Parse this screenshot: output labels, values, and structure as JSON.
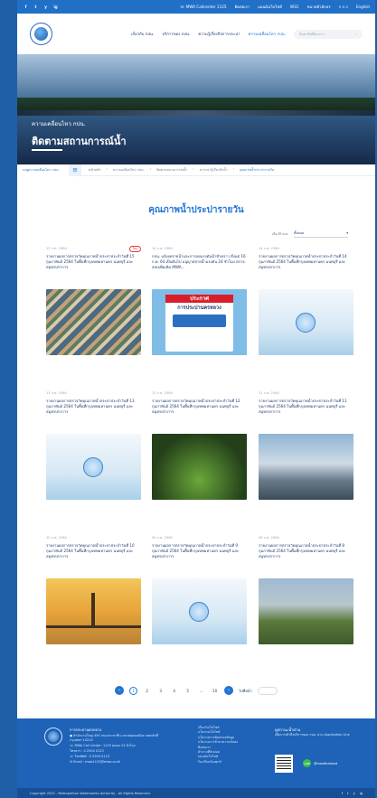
{
  "topbar": {
    "social": [
      "f",
      "t",
      "y",
      "ig"
    ],
    "callcenter": "MWA Callcenter 1125",
    "links": [
      "ติดต่อเรา",
      "แผนผังเว็บไซต์",
      "W3C",
      "ขนาดตัวอักษร",
      "ก ก ก",
      "English"
    ]
  },
  "header": {
    "nav": [
      "เกี่ยวกับ กปน.",
      "บริการของ กปน.",
      "ความรู้เรื่องกิจการประปา",
      "ความเคลื่อนไหว กปน."
    ],
    "search_placeholder": "ค้นหาสิ่งที่ต้องการ"
  },
  "hero": {
    "subtitle": "ความเคลื่อนไหว กปน.",
    "title": "ติดตามสถานการณ์น้ำ"
  },
  "breadcrumb": {
    "side_label": "เมนูความเคลื่อนไหว กปน.",
    "items": [
      "หน้าหลัก",
      "ความเคลื่อนไหว กปน.",
      "ติดตามสถานการณ์น้ำ",
      "สาระน่ารู้เกี่ยวกับน้ำ",
      "คุณภาพน้ำประปารายวัน"
    ]
  },
  "page_title": "คุณภาพน้ำประปารายวัน",
  "filter": {
    "label": "เลือกปี พ.ศ.",
    "value": "ทั้งหมด"
  },
  "cards": [
    {
      "date": "15 ก.พ. 2564",
      "badge": "ใหม่",
      "title": "รายงานผลการตรวจวัดคุณภาพน้ำประปาประจำวันที่ 15 กุมภาพันธ์ 2564 ในพื้นที่กรุงเทพมหานคร นนทบุรี และสมุทรปราการ",
      "img": "houses"
    },
    {
      "date": "14 ก.พ. 2564",
      "badge": "",
      "title": "กปน. แจ้งงดจ่ายน้ำและการลดแรงดันน้ำชั่วคราว ตั้งแต่ 16 ก.พ. 64 เป็นต้นไป อนุญาตจ่ายน้ำแรงดัน 24 ชั่วโมง ตรวจสอบเพิ่มเติม MWA...",
      "img": "announce"
    },
    {
      "date": "14 ก.พ. 2564",
      "badge": "",
      "title": "รายงานผลการตรวจวัดคุณภาพน้ำประปาประจำวันที่ 14 กุมภาพันธ์ 2564 ในพื้นที่กรุงเทพมหานคร นนทบุรี และสมุทรปราการ",
      "img": "water"
    },
    {
      "date": "13 ก.พ. 2564",
      "badge": "",
      "title": "รายงานผลการตรวจวัดคุณภาพน้ำประปาประจำวันที่ 13 กุมภาพันธ์ 2564 ในพื้นที่กรุงเทพมหานคร นนทบุรี และสมุทรปราการ",
      "img": "water"
    },
    {
      "date": "12 ก.พ. 2564",
      "badge": "",
      "title": "รายงานผลการตรวจวัดคุณภาพน้ำประปาประจำวันที่ 12 กุมภาพันธ์ 2564 ในพื้นที่กรุงเทพมหานคร นนทบุรี และสมุทรปราการ",
      "img": "plant"
    },
    {
      "date": "11 ก.พ. 2564",
      "badge": "",
      "title": "รายงานผลการตรวจวัดคุณภาพน้ำประปาประจำวันที่ 11 กุมภาพันธ์ 2564 ในพื้นที่กรุงเทพมหานคร นนทบุรี และสมุทรปราการ",
      "img": "city"
    },
    {
      "date": "10 ก.พ. 2564",
      "badge": "",
      "title": "รายงานผลการตรวจวัดคุณภาพน้ำประปาประจำวันที่ 10 กุมภาพันธ์ 2564 ในพื้นที่กรุงเทพมหานคร นนทบุรี และสมุทรปราการ",
      "img": "sunset"
    },
    {
      "date": "09 ก.พ. 2564",
      "badge": "",
      "title": "รายงานผลการตรวจวัดคุณภาพน้ำประปาประจำวันที่ 9 กุมภาพันธ์ 2564 ในพื้นที่กรุงเทพมหานคร นนทบุรี และสมุทรปราการ",
      "img": "water"
    },
    {
      "date": "08 ก.พ. 2564",
      "badge": "",
      "title": "รายงานผลการตรวจวัดคุณภาพน้ำประปาประจำวันที่ 8 กุมภาพันธ์ 2564 ในพื้นที่กรุงเทพมหานคร นนทบุรี และสมุทรปราการ",
      "img": "park"
    }
  ],
  "announce": {
    "header": "ประกาศ",
    "sub": "การประปานครหลวง"
  },
  "pagination": {
    "pages": [
      "1",
      "2",
      "3",
      "4",
      "5",
      "...",
      "10"
    ],
    "current": "1",
    "go_label": "ไปที่หน้า"
  },
  "footer": {
    "org": "การประปานครหลวง",
    "address": "สำนักงานใหญ่ 400 ถนนประชาชื่น แขวงทุ่งสองห้อง เขตหลักสี่ กรุงเทพฯ 10210",
    "callcenter": "MWA Call Center: 1125 ตลอด 24 ชั่วโมง",
    "fax": "โทรสาร : 0 2504 0123",
    "phone": "โทรศัพท์ : 0 2504 0123",
    "email": "Email : mwa1125@mwa.co.th",
    "links": [
      "เกี่ยวกับเว็บไซต์",
      "นโยบายเว็บไซต์",
      "นโยบายการคุ้มครองข้อมูล",
      "นโยบายการรักษาความมั่นคง",
      "ติดต่อเรา",
      "คำถามที่พบบ่อย",
      "แผนผังเว็บไซต์",
      "ร้องเรียนร้องทุกข์"
    ],
    "app_title": "ดูสถานะน้ำผ่าน",
    "app_desc": "เพื่อการเข้าถึงบริการของ กปน. ผ่าน Application Line",
    "line_label": "@mwathailand"
  },
  "copyright": "Copyright 2022 - Metropolitan Waterworks Authority - All Rights Reserved."
}
